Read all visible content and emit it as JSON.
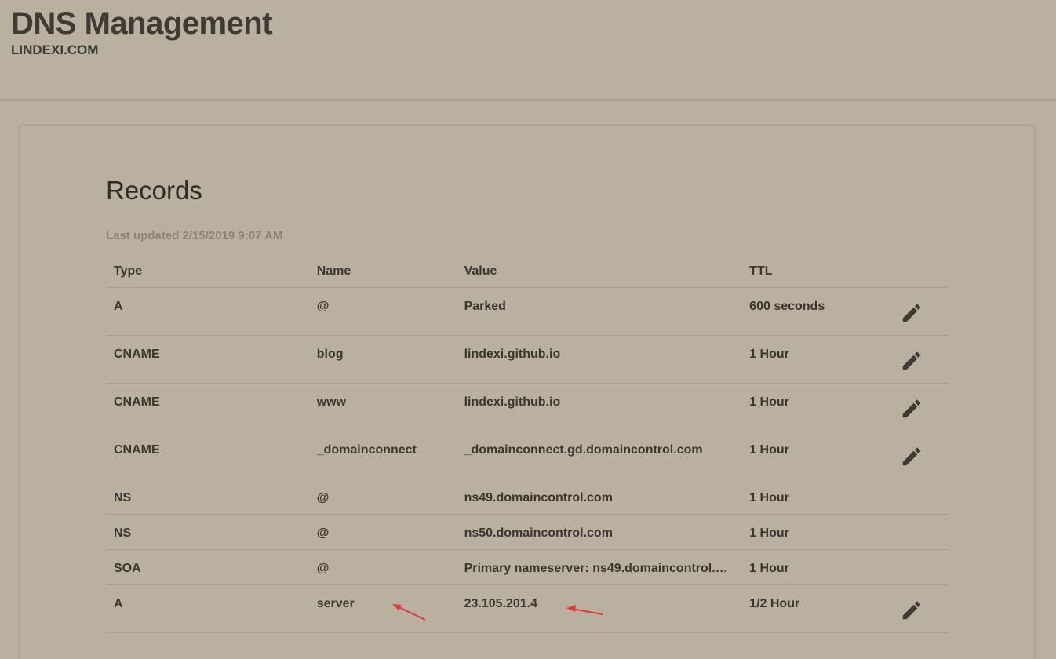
{
  "header": {
    "title": "DNS Management",
    "domain": "LINDEXI.COM"
  },
  "records": {
    "title": "Records",
    "last_updated": "Last updated 2/15/2019 9:07 AM",
    "columns": [
      "Type",
      "Name",
      "Value",
      "TTL"
    ],
    "rows": [
      {
        "type": "A",
        "name": "@",
        "value": "Parked",
        "ttl": "600 seconds",
        "editable": true
      },
      {
        "type": "CNAME",
        "name": "blog",
        "value": "lindexi.github.io",
        "ttl": "1 Hour",
        "editable": true
      },
      {
        "type": "CNAME",
        "name": "www",
        "value": "lindexi.github.io",
        "ttl": "1 Hour",
        "editable": true
      },
      {
        "type": "CNAME",
        "name": "_domainconnect",
        "value": "_domainconnect.gd.domaincontrol.com",
        "ttl": "1 Hour",
        "editable": true
      },
      {
        "type": "NS",
        "name": "@",
        "value": "ns49.domaincontrol.com",
        "ttl": "1 Hour",
        "editable": false
      },
      {
        "type": "NS",
        "name": "@",
        "value": "ns50.domaincontrol.com",
        "ttl": "1 Hour",
        "editable": false
      },
      {
        "type": "SOA",
        "name": "@",
        "value": "Primary nameserver: ns49.domaincontrol.co...",
        "ttl": "1 Hour",
        "editable": false
      },
      {
        "type": "A",
        "name": "server",
        "value": "23.105.201.4",
        "ttl": "1/2 Hour",
        "editable": true
      }
    ]
  },
  "icons": {
    "edit": "pencil-icon",
    "annotation": "red-arrow-icon"
  },
  "colors": {
    "background": "#b9b09f",
    "text": "#3b372f",
    "muted_text": "#8c8476",
    "annotation": "#e53935"
  }
}
